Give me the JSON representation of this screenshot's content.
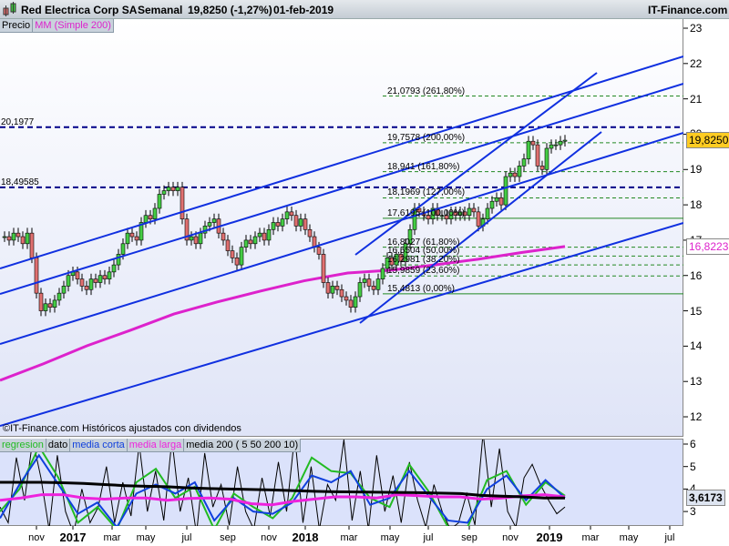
{
  "header": {
    "title": "Red Electrica Corp SA",
    "period": "Semanal",
    "quote": "19,8250 (-1,27%)",
    "date": "01-feb-2019",
    "site": "IT-Finance.com"
  },
  "legend_main": {
    "price": "Precio",
    "ma": "MM (Simple 200)"
  },
  "legend_lower": {
    "regresion": "regresion",
    "dato": "dato",
    "media_corta": "media corta",
    "media_larga": "media larga",
    "media200": "media 200 ( 5 50 200 10)"
  },
  "footnote": "©IT-Finance.com Históricos ajustados con dividendos",
  "colors": {
    "up": "#44cc44",
    "down": "#e07070",
    "ma": "#dd22cc",
    "trend": "#1030e0",
    "level": "#000088",
    "fib": "#228822"
  },
  "price_axis": {
    "ticks": [
      "23",
      "22",
      "21",
      "20",
      "19",
      "18",
      "17",
      "16",
      "15",
      "14",
      "13",
      "12"
    ]
  },
  "lower_axis": {
    "ticks": [
      "6",
      "5",
      "4",
      "3"
    ]
  },
  "last_price": "19,8250",
  "last_ma": "16,8223",
  "last_lower": "3,6173",
  "levels": [
    {
      "label": "20,1977",
      "value": 20.1977
    },
    {
      "label": "18,49585",
      "value": 18.49585
    }
  ],
  "fib": [
    {
      "label": "21,0793 (261,80%)",
      "value": 21.0793,
      "solid": false
    },
    {
      "label": "19,7578 (200,00%)",
      "value": 19.7578,
      "solid": false
    },
    {
      "label": "18,941 (161,80%)",
      "value": 18.941,
      "solid": false
    },
    {
      "label": "18,1969 (127,00%)",
      "value": 18.1969,
      "solid": false
    },
    {
      "label": "17,6195 (100,00%)",
      "value": 17.6195,
      "solid": true
    },
    {
      "label": "16,8027 (61,80%)",
      "value": 16.8027,
      "solid": false
    },
    {
      "label": "16,5504 (50,00%)",
      "value": 16.5504,
      "solid": false
    },
    {
      "label": "16,2981 (38,20%)",
      "value": 16.2981,
      "solid": false
    },
    {
      "label": "15,9859 (23,60%)",
      "value": 15.9859,
      "solid": false
    },
    {
      "label": "15,4813 (0,00%)",
      "value": 15.4813,
      "solid": true
    }
  ],
  "x_axis": [
    {
      "l": "nov",
      "b": false
    },
    {
      "l": "2017",
      "b": true
    },
    {
      "l": "mar",
      "b": false
    },
    {
      "l": "may",
      "b": false
    },
    {
      "l": "jul",
      "b": false
    },
    {
      "l": "sep",
      "b": false
    },
    {
      "l": "nov",
      "b": false
    },
    {
      "l": "2018",
      "b": true
    },
    {
      "l": "mar",
      "b": false
    },
    {
      "l": "may",
      "b": false
    },
    {
      "l": "jul",
      "b": false
    },
    {
      "l": "sep",
      "b": false
    },
    {
      "l": "nov",
      "b": false
    },
    {
      "l": "2019",
      "b": true
    },
    {
      "l": "mar",
      "b": false
    },
    {
      "l": "may",
      "b": false
    },
    {
      "l": "jul",
      "b": false
    }
  ],
  "closes": [
    17.1,
    17.0,
    17.2,
    17.1,
    16.9,
    17.2,
    16.5,
    15.5,
    15.0,
    15.2,
    15.1,
    15.3,
    15.5,
    15.7,
    16.0,
    16.1,
    15.9,
    15.7,
    15.6,
    15.9,
    15.8,
    16.0,
    15.9,
    16.1,
    16.3,
    16.6,
    16.9,
    17.2,
    17.1,
    17.0,
    17.5,
    17.7,
    17.6,
    17.9,
    18.3,
    18.4,
    18.5,
    18.4,
    18.5,
    17.6,
    17.0,
    17.1,
    16.9,
    17.2,
    17.4,
    17.5,
    17.6,
    17.2,
    17.0,
    16.7,
    16.5,
    16.3,
    16.8,
    17.0,
    16.9,
    17.1,
    17.2,
    17.0,
    17.3,
    17.5,
    17.4,
    17.6,
    17.8,
    17.7,
    17.4,
    17.6,
    17.3,
    17.1,
    16.8,
    16.6,
    15.8,
    15.5,
    15.7,
    15.6,
    15.4,
    15.3,
    15.1,
    15.4,
    15.8,
    15.9,
    15.7,
    15.6,
    15.9,
    16.2,
    16.5,
    16.3,
    16.6,
    16.4,
    16.9,
    17.3,
    17.9,
    17.8,
    17.7,
    17.6,
    17.9,
    17.7,
    17.7,
    17.6,
    17.8,
    17.7,
    17.8,
    17.7,
    17.9,
    17.8,
    17.4,
    17.6,
    17.9,
    18.1,
    18.2,
    18.0,
    18.8,
    18.9,
    18.8,
    19.1,
    19.3,
    19.8,
    19.7,
    19.1,
    19.0,
    19.6,
    19.7,
    19.7,
    19.8,
    19.83
  ],
  "ma200": [
    13.03,
    13.5,
    14.01,
    14.45,
    14.91,
    15.25,
    15.56,
    15.85,
    16.07,
    16.15,
    16.3,
    16.46,
    16.65,
    16.82
  ],
  "lower": {
    "media200": [
      4.3,
      4.3,
      4.3,
      4.28,
      4.25,
      4.2,
      4.15,
      4.12,
      4.1,
      4.05,
      4.02,
      4.0,
      3.98,
      3.96,
      3.93,
      3.9,
      3.88,
      3.87,
      3.86,
      3.85,
      3.84,
      3.82,
      3.8,
      3.72,
      3.68,
      3.65,
      3.6,
      3.6
    ],
    "media_larga": [
      3.5,
      3.6,
      3.75,
      3.75,
      3.6,
      3.55,
      3.6,
      3.6,
      3.5,
      3.58,
      3.6,
      3.55,
      3.35,
      3.3,
      3.45,
      3.55,
      3.65,
      3.65,
      3.6,
      3.75,
      3.7,
      3.65,
      3.65,
      3.55,
      3.6,
      3.7,
      3.75,
      3.65
    ],
    "media_corta": [
      2.7,
      4.2,
      5.5,
      4.2,
      2.9,
      3.4,
      2.3,
      3.8,
      4.2,
      3.8,
      4.3,
      2.6,
      3.6,
      3.0,
      2.9,
      3.4,
      4.6,
      4.3,
      4.8,
      3.3,
      3.6,
      4.8,
      3.7,
      2.6,
      2.5,
      4.0,
      4.6,
      3.5,
      4.4,
      3.6
    ],
    "regresion": [
      3.0,
      4.0,
      5.9,
      4.5,
      2.5,
      3.2,
      2.2,
      4.3,
      4.9,
      3.6,
      4.1,
      2.2,
      3.8,
      3.2,
      2.7,
      3.6,
      5.4,
      4.8,
      4.7,
      3.6,
      3.2,
      5.1,
      3.9,
      2.3,
      2.3,
      4.4,
      4.8,
      3.3,
      4.3,
      3.7
    ],
    "dato": [
      3.2,
      2.5,
      5.4,
      3.5,
      6.2,
      4.5,
      2.2,
      5.5,
      3.0,
      2.0,
      4.0,
      2.5,
      3.2,
      5.0,
      2.5,
      4.3,
      2.8,
      6.0,
      3.0,
      4.8,
      2.6,
      6.2,
      3.0,
      4.5,
      2.0,
      5.6,
      3.2,
      4.2,
      2.4,
      5.0,
      3.0,
      2.2,
      4.5,
      2.8,
      5.2,
      3.0,
      6.4,
      2.5,
      5.0,
      2.2,
      4.2,
      3.5,
      6.2,
      2.6,
      4.8,
      2.2,
      5.5,
      3.0,
      4.6,
      2.5,
      5.2,
      3.5,
      2.3,
      4.2,
      3.0,
      2.2,
      2.5,
      3.8,
      2.4,
      6.5,
      3.2,
      5.8,
      3.0,
      2.3,
      4.5,
      5.1,
      4.2,
      3.5,
      2.9,
      3.2
    ]
  }
}
